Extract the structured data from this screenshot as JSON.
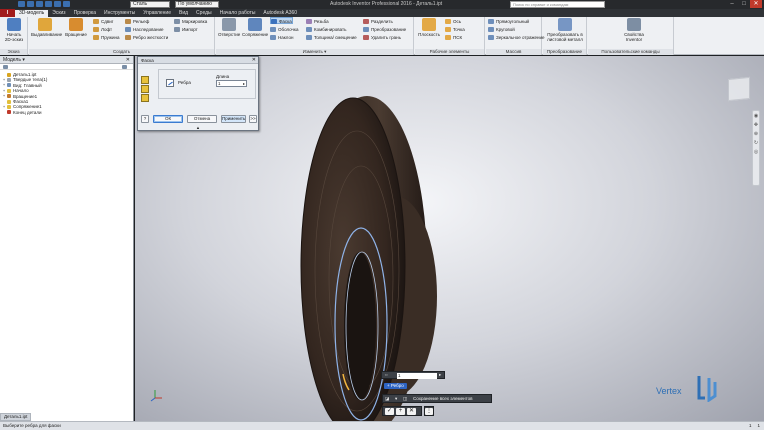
{
  "titlebar": {
    "material_combo": "Сталь",
    "appearance_combo": "По умолчанию",
    "document_title": "Autodesk Inventor Professional 2016 - Деталь1.ipt",
    "search_placeholder": "Поиск по справке и командам",
    "window_buttons": [
      "–",
      "□",
      "✕"
    ]
  },
  "tabs": {
    "app_label": "I",
    "items": [
      "3D-модель",
      "Эскиз",
      "Проверка",
      "Инструменты",
      "Управление",
      "Вид",
      "Среды",
      "Начало работы",
      "Autodesk A360"
    ]
  },
  "ribbon": {
    "panels": {
      "sketch": "Эскиз",
      "create": "Создать",
      "modify": "Изменить ▾",
      "work_features": "Рабочие элементы",
      "pattern": "Массив",
      "convert": "Преобразование",
      "custom": "Пользовательские команды"
    },
    "sketch_start": "Начать 2D-эскиз",
    "extrude": "Выдавливание",
    "revolve": "Вращение",
    "sweep": "Сдвиг",
    "loft": "Лофт",
    "coil": "Пружина",
    "emboss": "Рельеф",
    "derive": "Наследование",
    "rib": "Ребро жесткости",
    "unwrap": "Маркировка",
    "import": "Импорт",
    "hole": "Отверстие",
    "fillet": "Сопряжение",
    "chamfer": "Фаска",
    "shell": "Оболочка",
    "draft": "Наклон",
    "thread": "Резьба",
    "combine": "Комбинировать",
    "thicken": "Толщина/ смещение",
    "split": "Разделить",
    "direct": "Преобразование",
    "delete_face": "Удалить грань",
    "plane": "Плоскость",
    "axis": "Ось",
    "point": "Точка",
    "ucs": "ПСК",
    "rect_pattern": "Прямоугольный",
    "circ_pattern": "Круговой",
    "mirror": "Зеркальное отражение",
    "convert_sheet": "Преобразовать в листовой металл",
    "ilogic": "Свойства Inventor"
  },
  "browser": {
    "title": "Модель ▾",
    "tree": [
      {
        "label": "Деталь1.ipt",
        "expander": "",
        "color": "#d9a520"
      },
      {
        "label": "Твердые тела(1)",
        "expander": "+",
        "color": "#9aa3ad"
      },
      {
        "label": "Вид: Главный",
        "expander": "+",
        "color": "#6f8fb6"
      },
      {
        "label": "Начало",
        "expander": "+",
        "color": "#e2bf3b"
      },
      {
        "label": "Вращение1",
        "expander": "+",
        "color": "#c47b2d"
      },
      {
        "label": "Фаска1",
        "expander": "",
        "color": "#e2bf3b"
      },
      {
        "label": "Сопряжение1",
        "expander": "+",
        "color": "#e2bf3b"
      },
      {
        "label": "Конец детали",
        "expander": "",
        "color": "#c0392b"
      }
    ]
  },
  "dialog": {
    "title": "Фаска",
    "close": "✕",
    "edges_label": "Ребра",
    "distance_label": "Длина",
    "distance_value": "1",
    "help": "?",
    "ok": "ОК",
    "cancel": "Отмена",
    "apply": "Применить",
    "more": ">>",
    "grip": "▲"
  },
  "mini_toolbar": {
    "distance_value": "1",
    "edges_chip": "+ Ребро",
    "corner_label": "Сохранение всех элементов"
  },
  "watermark": "Vertex",
  "status": {
    "doc_tab": "Деталь1.ipt",
    "prompt": "Выберите ребра для фаски",
    "counter_a": "1",
    "counter_b": "1"
  },
  "colors": {
    "ribbon_bg": "#eef0f3",
    "app_button": "#a11c1c",
    "part_body": "#3a2c24",
    "selection": "#8fb3e8",
    "accent": "#2e64c2"
  }
}
